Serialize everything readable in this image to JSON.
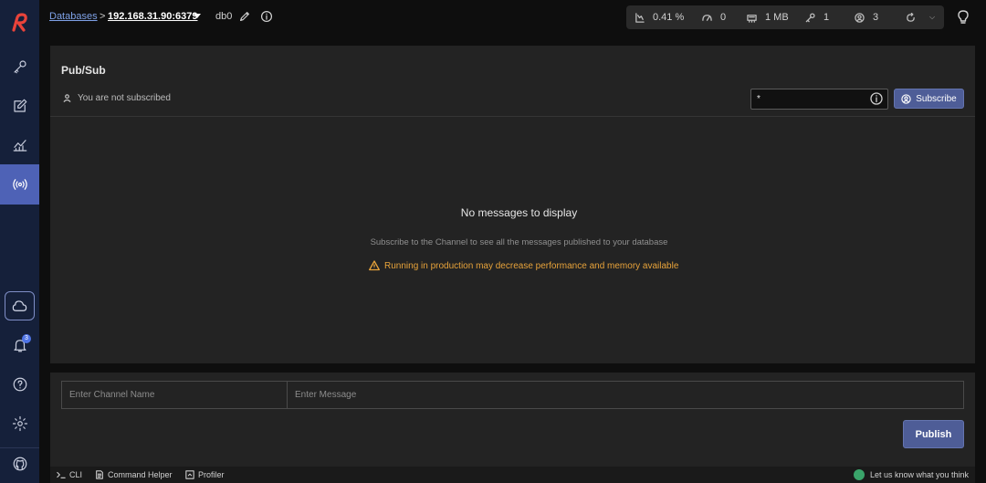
{
  "topbar": {
    "breadcrumb_databases": "Databases",
    "breadcrumb_sep": ">",
    "host": "192.168.31.90:6379",
    "db_name": "db0"
  },
  "stats": {
    "cpu": "0.41 %",
    "ops": "0",
    "memory": "1 MB",
    "keys": "1",
    "clients": "3"
  },
  "pubsub": {
    "title": "Pub/Sub",
    "status": "You are not subscribed",
    "channel_pattern": "*",
    "subscribe_label": "Subscribe",
    "empty_title": "No messages to display",
    "empty_subtitle": "Subscribe to the Channel to see all the messages published to your database",
    "warning": "Running in production may decrease performance and memory available"
  },
  "publish": {
    "channel_placeholder": "Enter Channel Name",
    "message_placeholder": "Enter Message",
    "button_label": "Publish"
  },
  "bottombar": {
    "cli": "CLI",
    "command_helper": "Command Helper",
    "profiler": "Profiler",
    "feedback": "Let us know what you think"
  },
  "sidebar": {
    "notification_count": "3"
  },
  "colors": {
    "accent": "#4e5d97",
    "sidebar_active": "#4e62b6",
    "warning": "#e8a33a",
    "logo_red": "#e8433a"
  }
}
